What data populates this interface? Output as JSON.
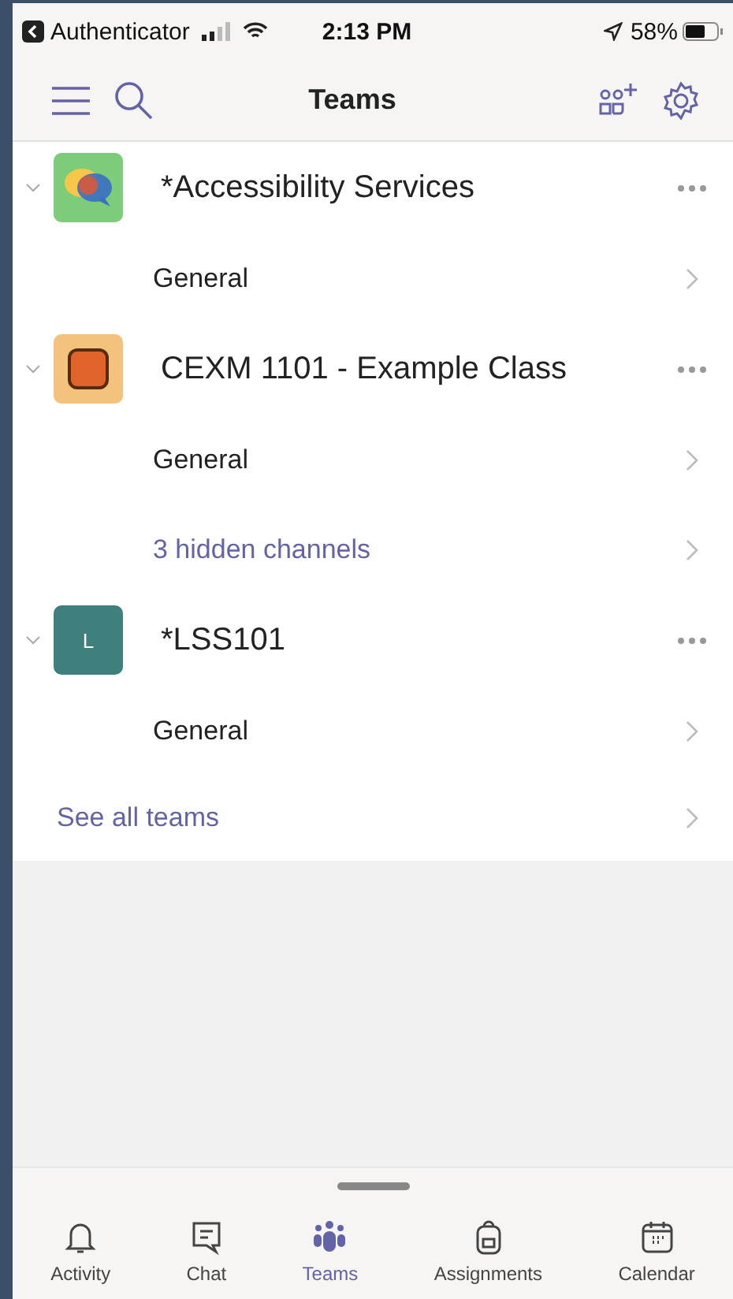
{
  "status_bar": {
    "back_app": "Authenticator",
    "time": "2:13 PM",
    "battery": "58%"
  },
  "header": {
    "title": "Teams"
  },
  "teams": [
    {
      "name": "*Accessibility Services",
      "expanded": true,
      "avatar": {
        "kind": "bubbles",
        "color": "#7dcc7a"
      },
      "channels": [
        {
          "name": "General",
          "kind": "channel"
        }
      ]
    },
    {
      "name": "CEXM 1101 - Example Class",
      "expanded": true,
      "avatar": {
        "kind": "tile",
        "color": "#f3c37e"
      },
      "channels": [
        {
          "name": "General",
          "kind": "channel"
        },
        {
          "name": "3 hidden channels",
          "kind": "hidden"
        }
      ]
    },
    {
      "name": "*LSS101",
      "expanded": true,
      "avatar": {
        "kind": "letter",
        "letter": "L",
        "color": "#3f7f7c"
      },
      "channels": [
        {
          "name": "General",
          "kind": "channel"
        }
      ]
    }
  ],
  "see_all": "See all teams",
  "nav": [
    {
      "label": "Activity",
      "selected": false
    },
    {
      "label": "Chat",
      "selected": false
    },
    {
      "label": "Teams",
      "selected": true
    },
    {
      "label": "Assignments",
      "selected": false
    },
    {
      "label": "Calendar",
      "selected": false
    }
  ]
}
